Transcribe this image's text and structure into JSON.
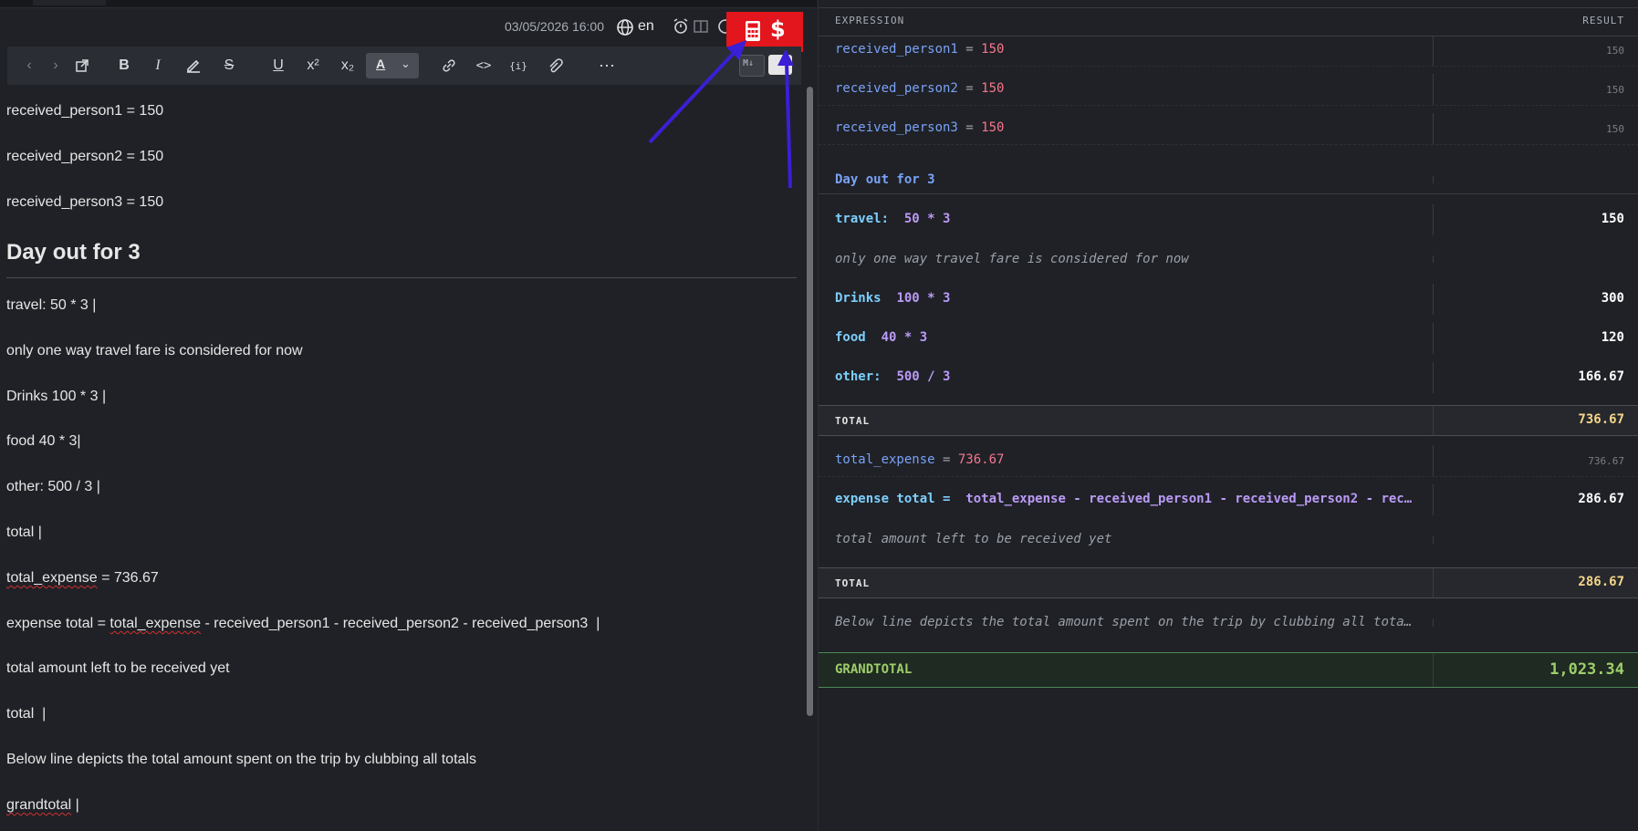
{
  "header": {
    "datetime": "03/05/2026 16:00",
    "language": "en"
  },
  "editor": {
    "lines": {
      "l1": "received_person1 = 150",
      "l2": "received_person2 = 150",
      "l3": "received_person3 = 150",
      "heading": "Day out for 3",
      "l4": "travel: 50 * 3 |",
      "l5": "only one way travel fare is considered for now",
      "l6": "Drinks 100 * 3 |",
      "l7": "food 40 * 3|",
      "l8": "other: 500 / 3 |",
      "l9": "total |",
      "l10_var": "total_expense",
      "l10_rest": " = 736.67",
      "l11_a": "expense total = ",
      "l11_var": "total_expense",
      "l11_rest": " - received_person1 - received_person2 - received_person3  |",
      "l12": "total amount left to be received yet",
      "l13": "total  |",
      "l14": "Below line depicts the total amount spent on the trip by clubbing all totals",
      "l15_var": "grandtotal",
      "l15_rest": " |"
    }
  },
  "results": {
    "col_expression": "EXPRESSION",
    "col_result": "RESULT",
    "r1": {
      "var": "received_person1",
      "eq": " = ",
      "num": "150",
      "val": "150"
    },
    "r2": {
      "var": "received_person2",
      "eq": " = ",
      "num": "150",
      "val": "150"
    },
    "r3": {
      "var": "received_person3",
      "eq": " = ",
      "num": "150",
      "val": "150"
    },
    "heading": "Day out for 3",
    "r4": {
      "label": "travel:",
      "expr": "50 * 3",
      "val": "150"
    },
    "r5": {
      "comment": "only one way travel fare is considered for now"
    },
    "r6": {
      "label": "Drinks",
      "expr": "100 * 3",
      "val": "300"
    },
    "r7": {
      "label": "food",
      "expr": "40 * 3",
      "val": "120"
    },
    "r8": {
      "label": "other:",
      "expr": "500 / 3",
      "val": "166.67"
    },
    "total1": {
      "label": "TOTAL",
      "val": "736.67"
    },
    "r9": {
      "var": "total_expense",
      "eq": " = ",
      "num": "736.67",
      "val": "736.67"
    },
    "r10": {
      "label": "expense total =",
      "expr": "total_expense - received_person1 - received_person2 - rec…",
      "val": "286.67"
    },
    "r11": {
      "comment": "total amount left to be received yet"
    },
    "total2": {
      "label": "TOTAL",
      "val": "286.67"
    },
    "r12": {
      "comment": "Below line depicts the total amount spent on the trip by clubbing all tota…"
    },
    "grand": {
      "label": "GRANDTOTAL",
      "val": "1,023.34"
    }
  },
  "colors": {
    "highlight_box": "#e3161d",
    "annotation_arrow": "#3a1fd6",
    "accent_green": "#9ece6a",
    "total_yellow": "#f5d78a"
  }
}
